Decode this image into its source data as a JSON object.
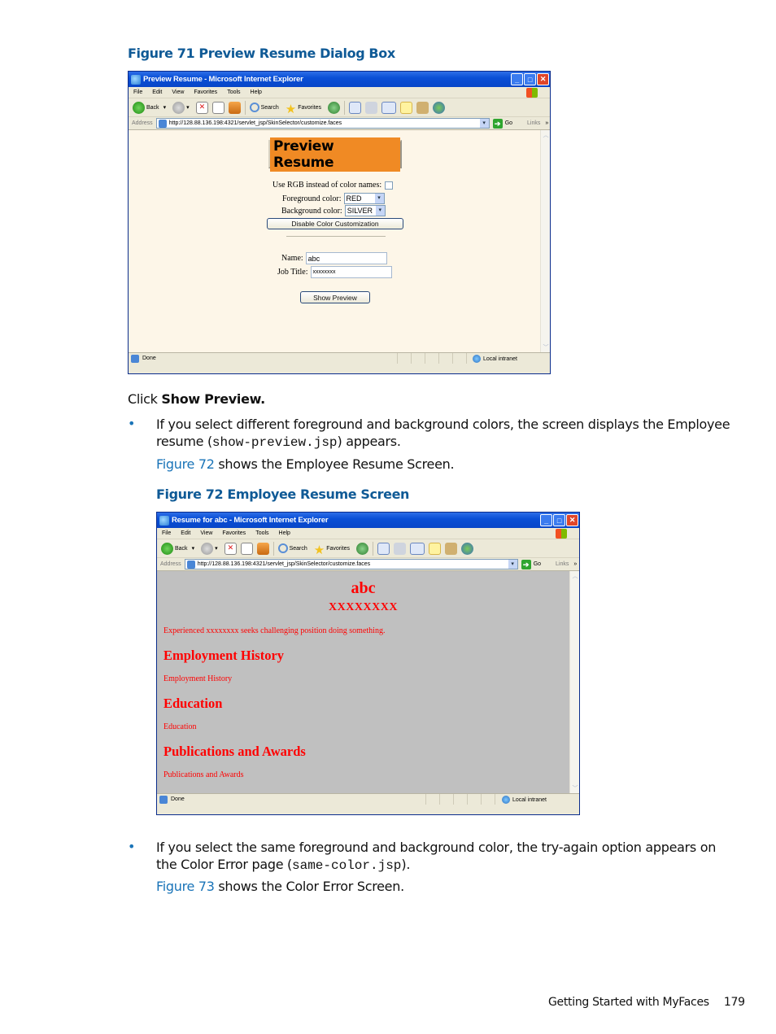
{
  "figure71": {
    "caption": "Figure 71 Preview Resume Dialog Box",
    "window": {
      "title": "Preview Resume - Microsoft Internet Explorer",
      "menu": [
        "File",
        "Edit",
        "View",
        "Favorites",
        "Tools",
        "Help"
      ],
      "toolbar": {
        "back": "Back",
        "search": "Search",
        "favorites": "Favorites"
      },
      "address_label": "Address",
      "url": "http://128.88.136.198:4321/servlet_jsp/SkinSelector/customize.faces",
      "go": "Go",
      "links": "Links",
      "status": "Done",
      "zone": "Local intranet"
    },
    "page": {
      "banner": "Preview Resume",
      "use_rgb_label": "Use RGB instead of color names:",
      "use_rgb_checked": false,
      "fg_label": "Foreground color:",
      "fg_value": "RED",
      "bg_label": "Background color:",
      "bg_value": "SILVER",
      "disable_button": "Disable Color Customization",
      "name_label": "Name:",
      "name_value": "abc",
      "job_label": "Job Title:",
      "job_value": "xxxxxxxx",
      "show_preview_button": "Show Preview"
    }
  },
  "body_text": {
    "click_prefix": "Click ",
    "click_bold": "Show Preview.",
    "bullet1_part1": "If you select different foreground and background colors, the screen displays the Employee resume (",
    "bullet1_code": "show-preview.jsp",
    "bullet1_part2": ") appears.",
    "fig72_link": "Figure 72",
    "fig72_ref_rest": " shows the Employee Resume Screen.",
    "bullet2_part1": "If you select the same foreground and background color, the try-again option appears on the Color Error page (",
    "bullet2_code": "same-color.jsp",
    "bullet2_part2": ").",
    "fig73_link": "Figure 73",
    "fig73_ref_rest": " shows the Color Error Screen."
  },
  "figure72": {
    "caption": "Figure 72 Employee Resume Screen",
    "window": {
      "title": "Resume for abc - Microsoft Internet Explorer",
      "menu": [
        "File",
        "Edit",
        "View",
        "Favorites",
        "Tools",
        "Help"
      ],
      "toolbar": {
        "back": "Back",
        "search": "Search",
        "favorites": "Favorites"
      },
      "address_label": "Address",
      "url": "http://128.88.136.198:4321/servlet_jsp/SkinSelector/customize.faces",
      "go": "Go",
      "links": "Links",
      "status": "Done",
      "zone": "Local intranet"
    },
    "page": {
      "name": "abc",
      "job": "XXXXXXXX",
      "objective": "Experienced xxxxxxxx seeks challenging position doing something.",
      "sections": [
        {
          "heading": "Employment History",
          "body": "Employment History"
        },
        {
          "heading": "Education",
          "body": "Education"
        },
        {
          "heading": "Publications and Awards",
          "body": "Publications and Awards"
        }
      ]
    }
  },
  "footer": {
    "section": "Getting Started with MyFaces",
    "page_number": "179"
  }
}
